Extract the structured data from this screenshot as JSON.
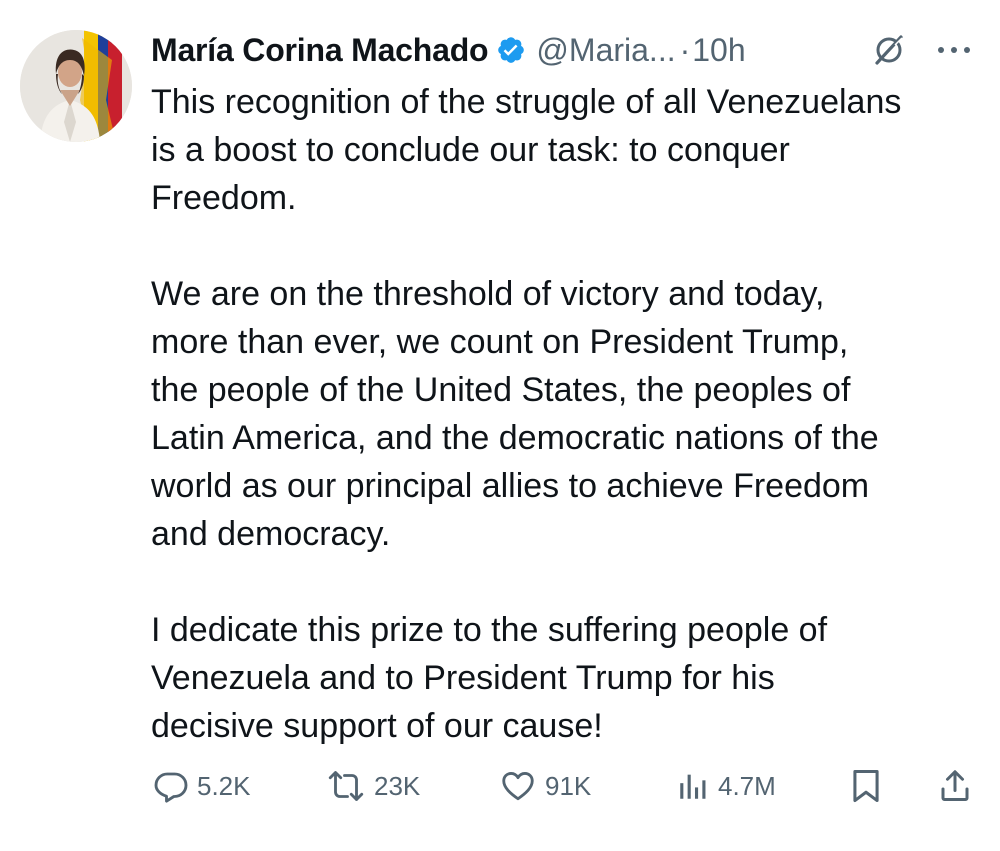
{
  "author": {
    "name": "María Corina Machado",
    "handle": "@Maria...",
    "separator": "·",
    "time": "10h"
  },
  "tweet": {
    "paragraphs": [
      "This recognition of the struggle of all Venezuelans\nis a boost to conclude our task: to conquer\nFreedom.",
      "We are on the threshold of victory and today,\nmore than ever, we count on President Trump,\nthe people of the United States, the peoples of\nLatin America, and the democratic nations of the\nworld as our principal allies to achieve Freedom\nand democracy.",
      "I dedicate this prize to the suffering people of\nVenezuela and to President Trump for his\ndecisive support of our cause!"
    ]
  },
  "actions": {
    "replies": "5.2K",
    "reposts": "23K",
    "likes": "91K",
    "views": "4.7M"
  },
  "icons": {
    "verified": "verified-badge-icon",
    "grok": "grok-icon",
    "more": "more-options-icon",
    "reply": "reply-icon",
    "repost": "repost-icon",
    "like": "heart-icon",
    "views": "views-icon",
    "bookmark": "bookmark-icon",
    "share": "share-icon"
  },
  "colors": {
    "text": "#0f1419",
    "secondary": "#536471",
    "verified": "#1d9bf0"
  }
}
